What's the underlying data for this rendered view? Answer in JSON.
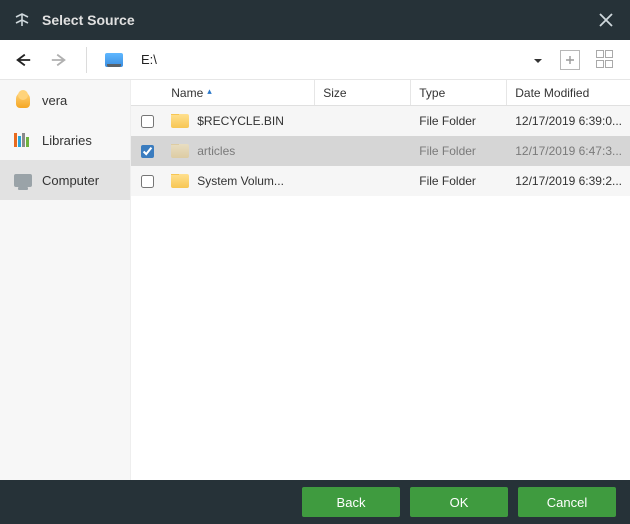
{
  "window": {
    "title": "Select Source"
  },
  "toolbar": {
    "path": "E:\\"
  },
  "sidebar": {
    "items": [
      {
        "label": "vera",
        "icon": "user",
        "selected": false
      },
      {
        "label": "Libraries",
        "icon": "libraries",
        "selected": false
      },
      {
        "label": "Computer",
        "icon": "computer",
        "selected": true
      }
    ]
  },
  "columns": {
    "name": "Name",
    "size": "Size",
    "type": "Type",
    "date": "Date Modified"
  },
  "rows": [
    {
      "checked": false,
      "name": "$RECYCLE.BIN",
      "size": "",
      "type": "File Folder",
      "date": "12/17/2019 6:39:0...",
      "selected": false
    },
    {
      "checked": true,
      "name": "articles",
      "size": "",
      "type": "File Folder",
      "date": "12/17/2019 6:47:3...",
      "selected": true
    },
    {
      "checked": false,
      "name": "System Volum...",
      "size": "",
      "type": "File Folder",
      "date": "12/17/2019 6:39:2...",
      "selected": false
    }
  ],
  "buttons": {
    "back": "Back",
    "ok": "OK",
    "cancel": "Cancel"
  }
}
